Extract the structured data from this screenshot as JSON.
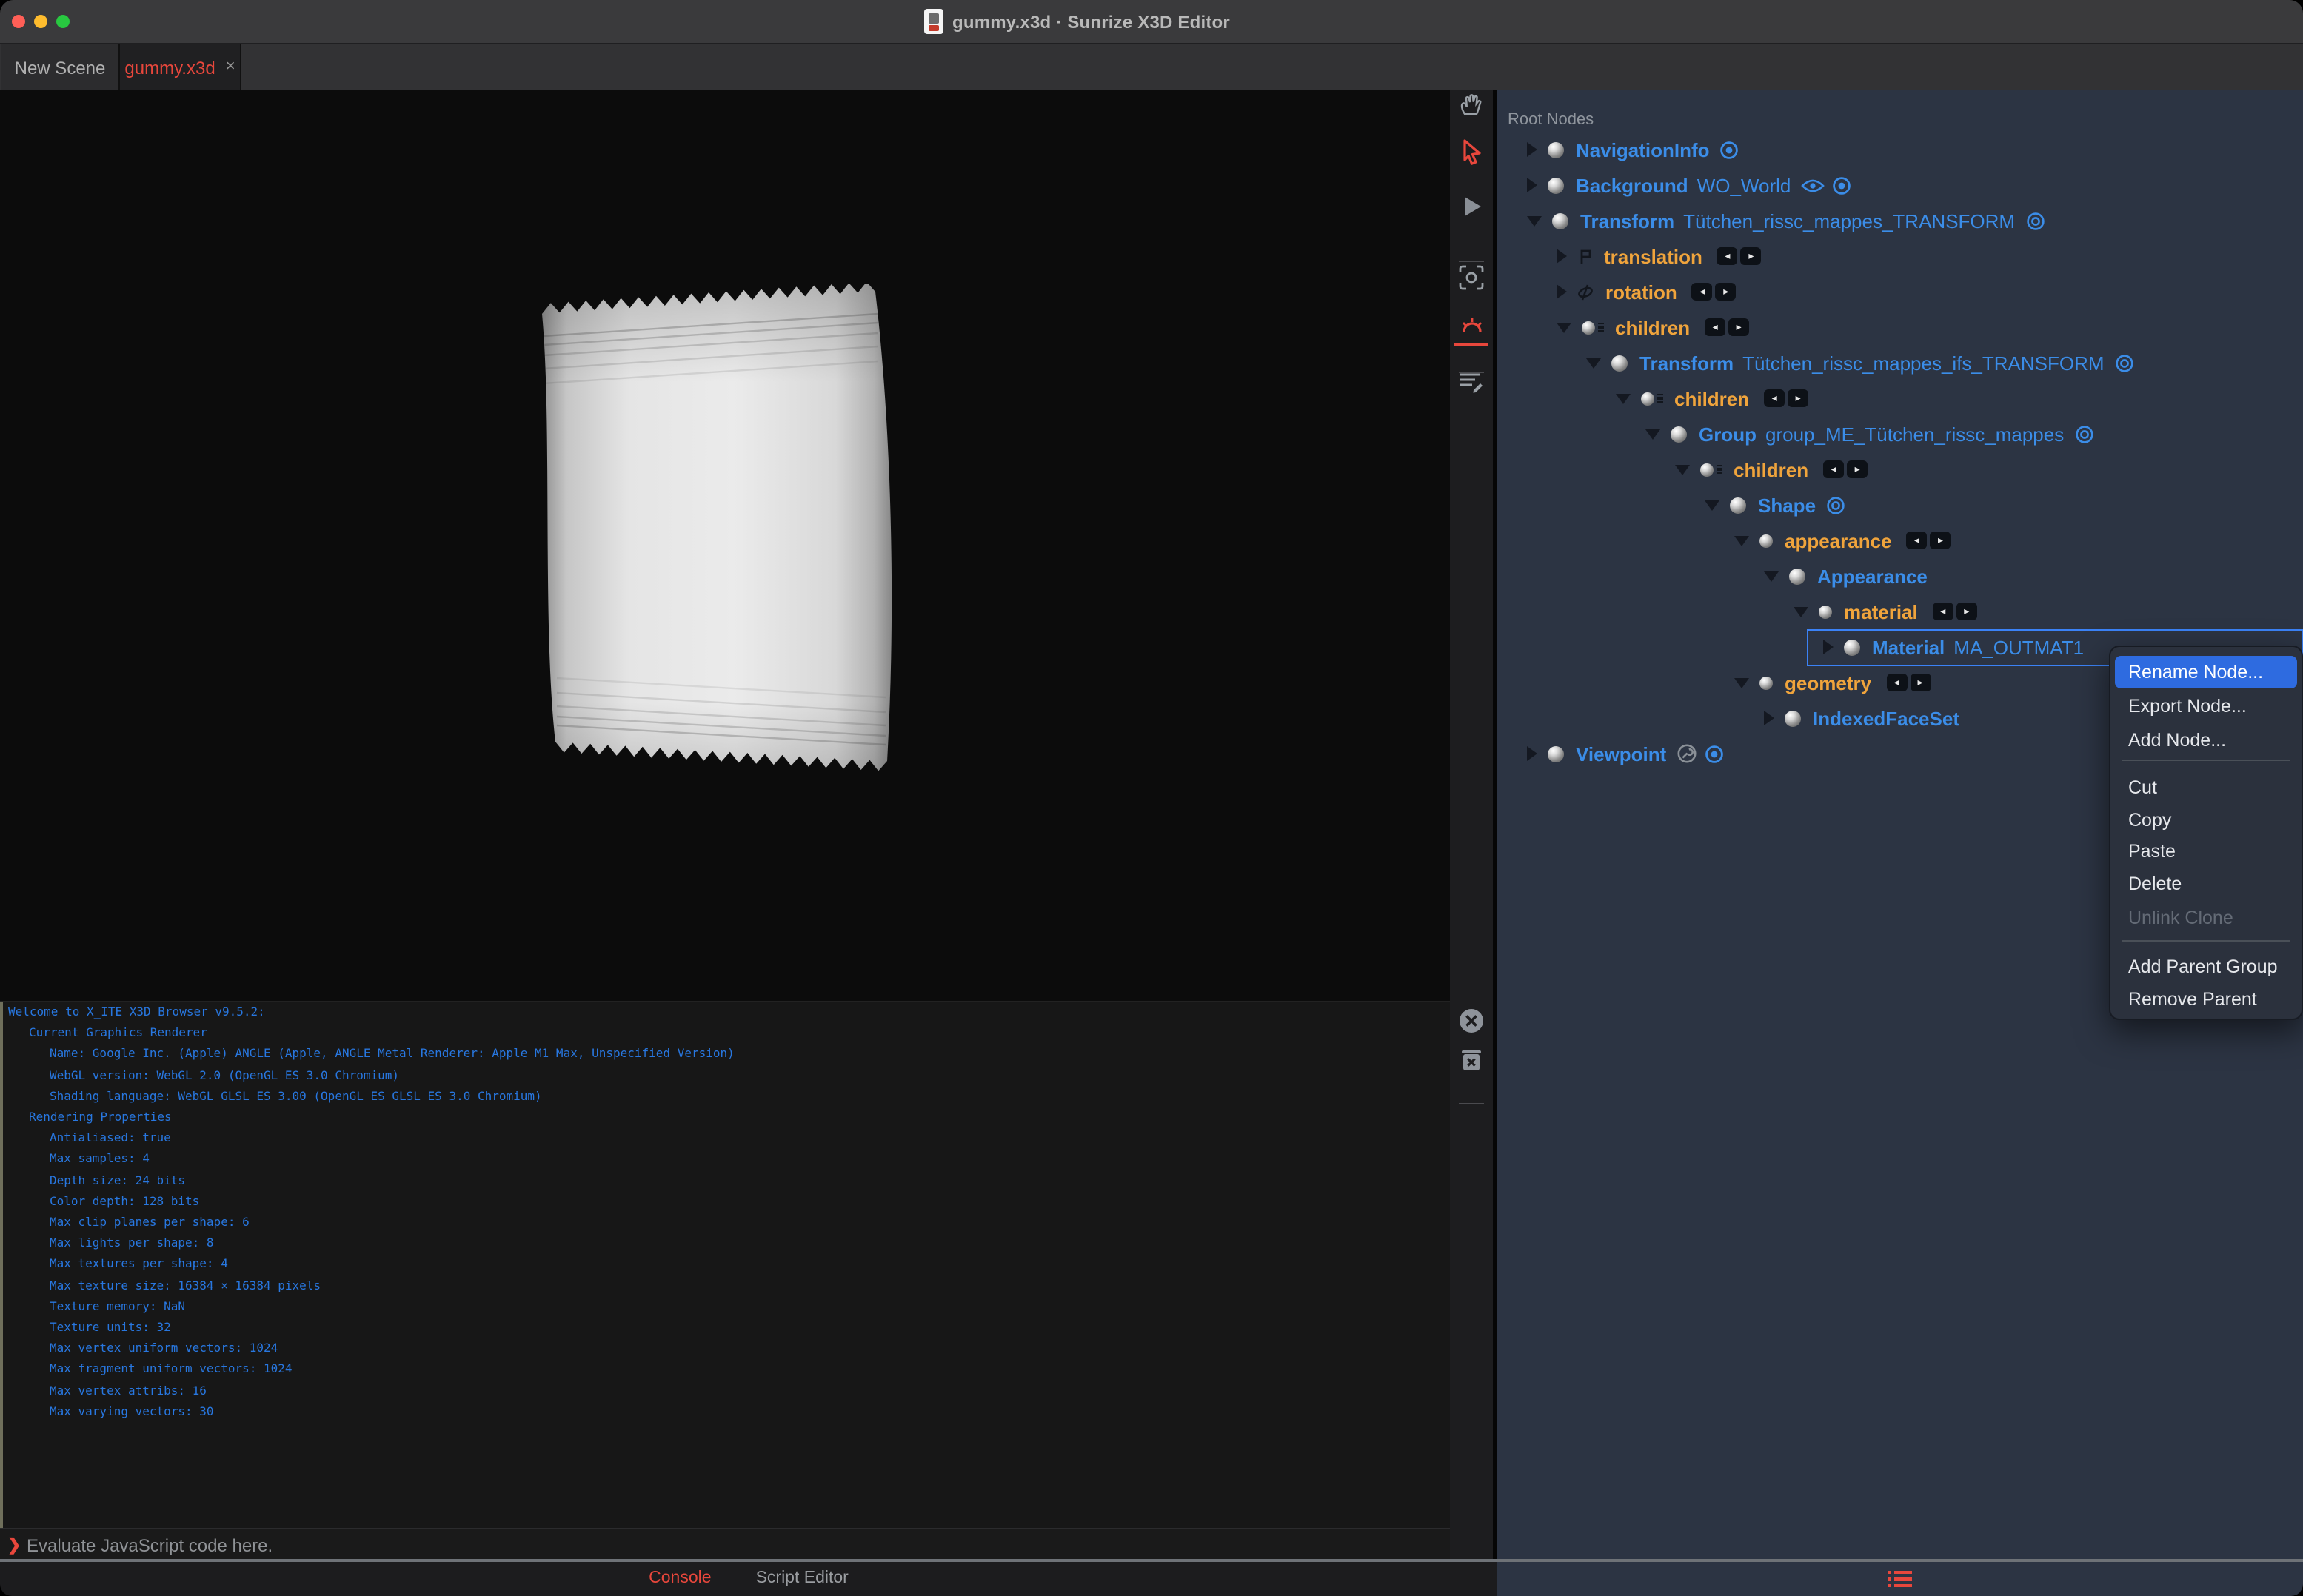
{
  "window": {
    "title": "gummy.x3d · Sunrize X3D Editor",
    "doc_icon": "x3d-document-icon",
    "traffic_lights": [
      "close",
      "minimize",
      "zoom"
    ]
  },
  "tabs": [
    {
      "label": "New Scene",
      "active": false
    },
    {
      "label": "gummy.x3d",
      "active": true,
      "close_glyph": "×"
    }
  ],
  "viewport": {
    "object": "white flow-wrap pouch render"
  },
  "toolbar": {
    "items": [
      {
        "kind": "button",
        "icon": "hand-pan-icon",
        "active": false
      },
      {
        "kind": "button",
        "icon": "select-arrow-icon",
        "active": true
      },
      {
        "kind": "button",
        "icon": "play-icon",
        "active": false
      },
      {
        "kind": "divider"
      },
      {
        "kind": "button",
        "icon": "viewfinder-icon",
        "active": false
      },
      {
        "kind": "button",
        "icon": "light-icon",
        "active": true
      },
      {
        "kind": "divider"
      },
      {
        "kind": "button",
        "icon": "script-edit-icon",
        "active": false
      }
    ],
    "console_actions": [
      {
        "kind": "button",
        "icon": "close-circle-icon"
      },
      {
        "kind": "button",
        "icon": "trash-icon"
      },
      {
        "kind": "divider"
      }
    ]
  },
  "console": {
    "lines": [
      {
        "indent": 0,
        "text": "Welcome to X_ITE X3D Browser v9.5.2:"
      },
      {
        "indent": 1,
        "text": "Current Graphics Renderer"
      },
      {
        "indent": 2,
        "text": "Name: Google Inc. (Apple) ANGLE (Apple, ANGLE Metal Renderer: Apple M1 Max, Unspecified Version)"
      },
      {
        "indent": 2,
        "text": "WebGL version: WebGL 2.0 (OpenGL ES 3.0 Chromium)"
      },
      {
        "indent": 2,
        "text": "Shading language: WebGL GLSL ES 3.00 (OpenGL ES GLSL ES 3.0 Chromium)"
      },
      {
        "indent": 1,
        "text": "Rendering Properties"
      },
      {
        "indent": 2,
        "text": "Antialiased: true"
      },
      {
        "indent": 2,
        "text": "Max samples: 4"
      },
      {
        "indent": 2,
        "text": "Depth size: 24 bits"
      },
      {
        "indent": 2,
        "text": "Color depth: 128 bits"
      },
      {
        "indent": 2,
        "text": "Max clip planes per shape: 6"
      },
      {
        "indent": 2,
        "text": "Max lights per shape: 8"
      },
      {
        "indent": 2,
        "text": "Max textures per shape: 4"
      },
      {
        "indent": 2,
        "text": "Max texture size: 16384 × 16384 pixels"
      },
      {
        "indent": 2,
        "text": "Texture memory: NaN"
      },
      {
        "indent": 2,
        "text": "Texture units: 32"
      },
      {
        "indent": 2,
        "text": "Max vertex uniform vectors: 1024"
      },
      {
        "indent": 2,
        "text": "Max fragment uniform vectors: 1024"
      },
      {
        "indent": 2,
        "text": "Max vertex attribs: 16"
      },
      {
        "indent": 2,
        "text": "Max varying vectors: 30"
      }
    ],
    "prompt": "❯",
    "placeholder": "Evaluate JavaScript code here.",
    "bottom_tabs": [
      {
        "label": "Console",
        "active": true
      },
      {
        "label": "Script Editor",
        "active": false
      }
    ]
  },
  "outline": {
    "header": "Root Nodes",
    "footer_icon": "outline-list-icon",
    "rows": [
      {
        "kind": "node",
        "level": 0,
        "expander": "closed",
        "type": "NavigationInfo",
        "def": "",
        "icons": [
          "bound-icon"
        ]
      },
      {
        "kind": "node",
        "level": 0,
        "expander": "closed",
        "type": "Background",
        "def": "WO_World",
        "icons": [
          "eye-icon",
          "bound-icon"
        ]
      },
      {
        "kind": "node",
        "level": 0,
        "expander": "open",
        "type": "Transform",
        "def": "Tütchen_rissc_mappes_TRANSFORM",
        "icons": [
          "visibility-icon"
        ]
      },
      {
        "kind": "field",
        "level": 1,
        "expander": "closed",
        "name": "translation",
        "icon": "translation-icon",
        "badges": true
      },
      {
        "kind": "field",
        "level": 1,
        "expander": "closed",
        "name": "rotation",
        "icon": "rotation-icon",
        "badges": true
      },
      {
        "kind": "field",
        "level": 1,
        "expander": "open",
        "name": "children",
        "icon": "mfnode-icon",
        "badges": true
      },
      {
        "kind": "node",
        "level": 2,
        "expander": "open",
        "type": "Transform",
        "def": "Tütchen_rissc_mappes_ifs_TRANSFORM",
        "icons": [
          "visibility-icon"
        ]
      },
      {
        "kind": "field",
        "level": 3,
        "expander": "open",
        "name": "children",
        "icon": "mfnode-icon",
        "badges": true
      },
      {
        "kind": "node",
        "level": 4,
        "expander": "open",
        "type": "Group",
        "def": "group_ME_Tütchen_rissc_mappes",
        "icons": [
          "visibility-icon"
        ]
      },
      {
        "kind": "field",
        "level": 5,
        "expander": "open",
        "name": "children",
        "icon": "mfnode-icon",
        "badges": true
      },
      {
        "kind": "node",
        "level": 6,
        "expander": "open",
        "type": "Shape",
        "def": "",
        "icons": [
          "visibility-icon"
        ]
      },
      {
        "kind": "field",
        "level": 7,
        "expander": "open",
        "name": "appearance",
        "icon": "sfnode-icon",
        "badges": true
      },
      {
        "kind": "node",
        "level": 8,
        "expander": "open",
        "type": "Appearance",
        "def": "",
        "icons": []
      },
      {
        "kind": "field",
        "level": 9,
        "expander": "open",
        "name": "material",
        "icon": "sfnode-icon",
        "badges": true
      },
      {
        "kind": "node",
        "level": 10,
        "expander": "closed",
        "type": "Material",
        "def": "MA_OUTMAT1",
        "icons": [],
        "selected": true
      },
      {
        "kind": "field",
        "level": 7,
        "expander": "open",
        "name": "geometry",
        "icon": "sfnode-icon",
        "badges": true
      },
      {
        "kind": "node",
        "level": 8,
        "expander": "closed",
        "type": "IndexedFaceSet",
        "def": "",
        "icons": []
      },
      {
        "kind": "node",
        "level": 0,
        "expander": "closed",
        "type": "Viewpoint",
        "def": "",
        "icons": [
          "tool-icon",
          "bound-icon"
        ]
      }
    ]
  },
  "context_menu": {
    "items": [
      {
        "label": "Rename Node...",
        "highlighted": true
      },
      {
        "label": "Export Node..."
      },
      {
        "label": "Add Node..."
      },
      {
        "separator": true
      },
      {
        "label": "Cut"
      },
      {
        "label": "Copy"
      },
      {
        "label": "Paste"
      },
      {
        "label": "Delete"
      },
      {
        "label": "Unlink Clone",
        "disabled": true
      },
      {
        "separator": true
      },
      {
        "label": "Add Parent Group"
      },
      {
        "label": "Remove Parent"
      }
    ]
  },
  "colors": {
    "accent_red": "#e8473c",
    "node_blue": "#3b8de8",
    "field_orange": "#f0a43c",
    "selection_blue": "#2e6be0",
    "panel_bg": "#2c3443",
    "console_text": "#2877e0"
  }
}
